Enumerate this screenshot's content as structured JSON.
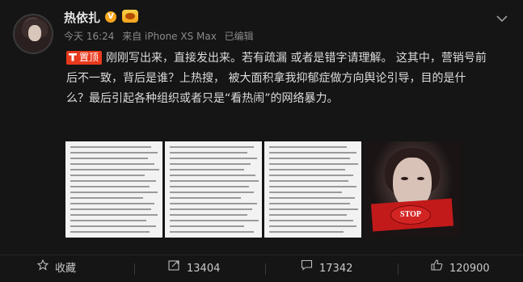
{
  "user": {
    "name": "热依扎",
    "verified_icon": "verified-badge",
    "member_icon": "member-badge"
  },
  "meta": {
    "time": "今天 16:24",
    "source": "来自 iPhone XS Max",
    "edited": "已编辑"
  },
  "post": {
    "pin_label": "置顶",
    "text": "刚刚写出来，直接发出来。若有疏漏 或者是错字请理解。 这其中，营销号前后不一致，背后是谁？上热搜， 被大面积拿我抑郁症做方向舆论引导，目的是什么？最后引起各种组织或者只是“看热闹”的网络暴力。"
  },
  "images": [
    {
      "type": "text-screenshot"
    },
    {
      "type": "text-screenshot"
    },
    {
      "type": "text-screenshot"
    },
    {
      "type": "photo",
      "stop_text": "STOP"
    }
  ],
  "actions": {
    "favorite_label": "收藏",
    "repost_count": "13404",
    "comment_count": "17342",
    "like_count": "120900"
  },
  "colors": {
    "background": "#151515",
    "pin_red": "#e8391d",
    "verified": "#f7a51c"
  }
}
